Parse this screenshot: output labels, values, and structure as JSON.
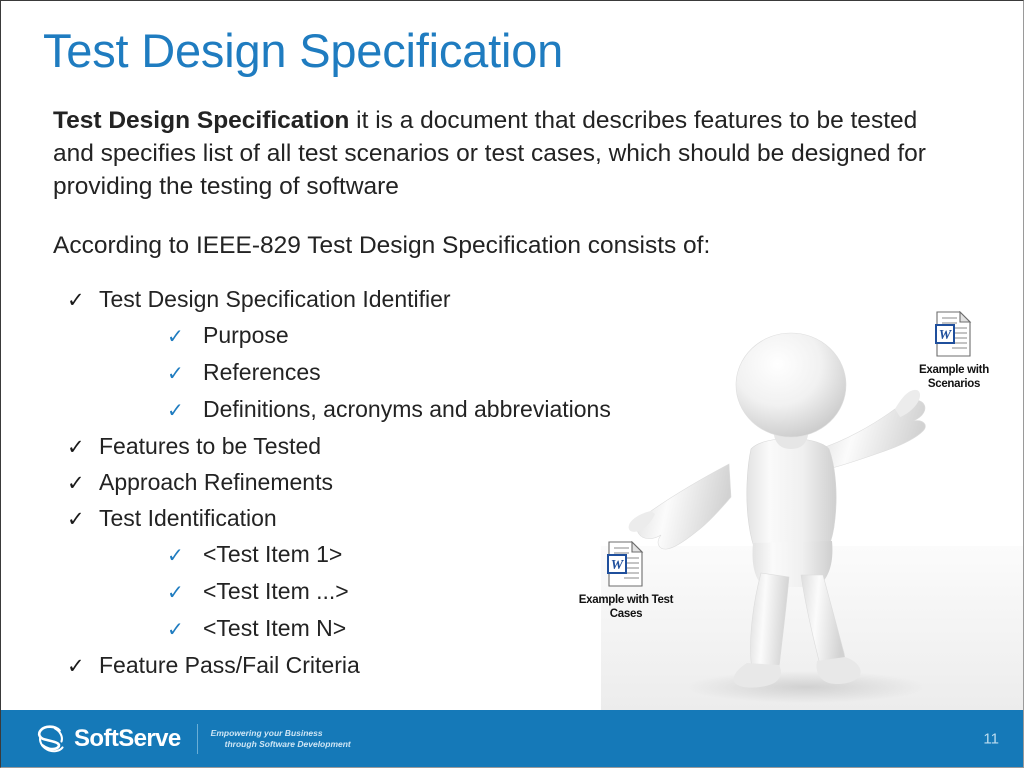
{
  "slide": {
    "title": "Test Design Specification",
    "title_color": "#1f7cc0",
    "background": "#ffffff"
  },
  "body": {
    "paragraph1_bold": "Test Design Specification",
    "paragraph1_rest": " it is a document that describes features to be tested and specifies list of all test scenarios or test cases, which should be designed for providing the testing of software",
    "paragraph2": "According to IEEE-829 Test Design Specification consists of:"
  },
  "checklist": {
    "mark_glyph": "✓",
    "level1_mark_color": "#1a1a1a",
    "level2_mark_color": "#1f7cc0",
    "items": [
      {
        "level": 1,
        "label": "Test Design Specification Identifier"
      },
      {
        "level": 2,
        "label": "Purpose"
      },
      {
        "level": 2,
        "label": "References"
      },
      {
        "level": 2,
        "label": "Definitions, acronyms and abbreviations"
      },
      {
        "level": 1,
        "label": "Features to be Tested"
      },
      {
        "level": 1,
        "label": "Approach Refinements"
      },
      {
        "level": 1,
        "label": "Test Identification"
      },
      {
        "level": 2,
        "label": "<Test Item 1>"
      },
      {
        "level": 2,
        "label": "<Test Item ...>"
      },
      {
        "level": 2,
        "label": "<Test Item N>"
      },
      {
        "level": 1,
        "label": "Feature Pass/Fail Criteria"
      }
    ]
  },
  "attachments": [
    {
      "icon": "word-document-icon",
      "caption_line1": "Example with",
      "caption_line2": "Scenarios"
    },
    {
      "icon": "word-document-icon",
      "caption_line1": "Example with Test",
      "caption_line2": "Cases"
    }
  ],
  "illustration": {
    "name": "3d-mannequin-figure",
    "description": "White 3D mannequin with arms outstretched"
  },
  "footer": {
    "background": "#1579b8",
    "logo_name": "SoftServe",
    "tagline_line1": "Empowering your Business",
    "tagline_line2": "through Software Development",
    "page_number": "11"
  }
}
